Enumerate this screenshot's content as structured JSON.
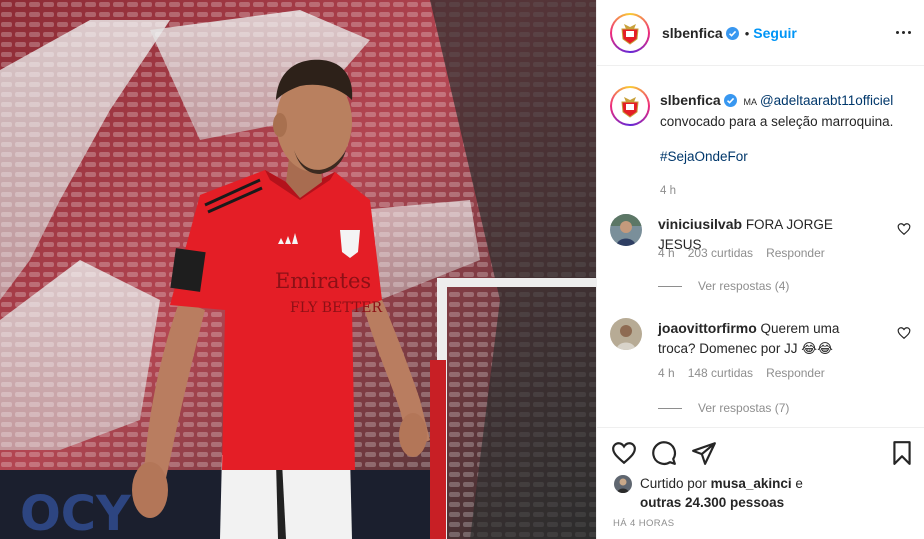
{
  "post": {
    "username": "slbenfica",
    "follow_label": "Seguir",
    "separator": "•",
    "caption": {
      "username": "slbenfica",
      "tag": "MA",
      "mention": "@adeltaarabt11officiel",
      "text": "convocado para a seleção marroquina.",
      "hashtag": "#SejaOndeFor",
      "time": "4 h"
    },
    "comments": [
      {
        "username": "viniciusilvab",
        "text": "FORA JORGE JESUS",
        "time": "4 h",
        "likes": "203 curtidas",
        "reply_label": "Responder",
        "view_replies": "Ver respostas (4)"
      },
      {
        "username": "joaovittorfirmo",
        "text": "Querem uma troca? Domenec por JJ 😂😂",
        "time": "4 h",
        "likes": "148 curtidas",
        "reply_label": "Responder",
        "view_replies": "Ver respostas (7)"
      }
    ],
    "liked_by": {
      "prefix": "Curtido por",
      "user": "musa_akinci",
      "conjunction": "e",
      "others": "outras 24.300 pessoas"
    },
    "timestamp": "HÁ 4 HORAS",
    "icons": [
      "verified-badge-icon",
      "more-options-icon",
      "heart-icon",
      "comment-icon",
      "share-icon",
      "bookmark-icon"
    ],
    "colors": {
      "link_blue": "#0095f6",
      "mention_blue": "#00376b",
      "meta_gray": "#8e8e8e",
      "jersey_red": "#e41e26"
    }
  }
}
